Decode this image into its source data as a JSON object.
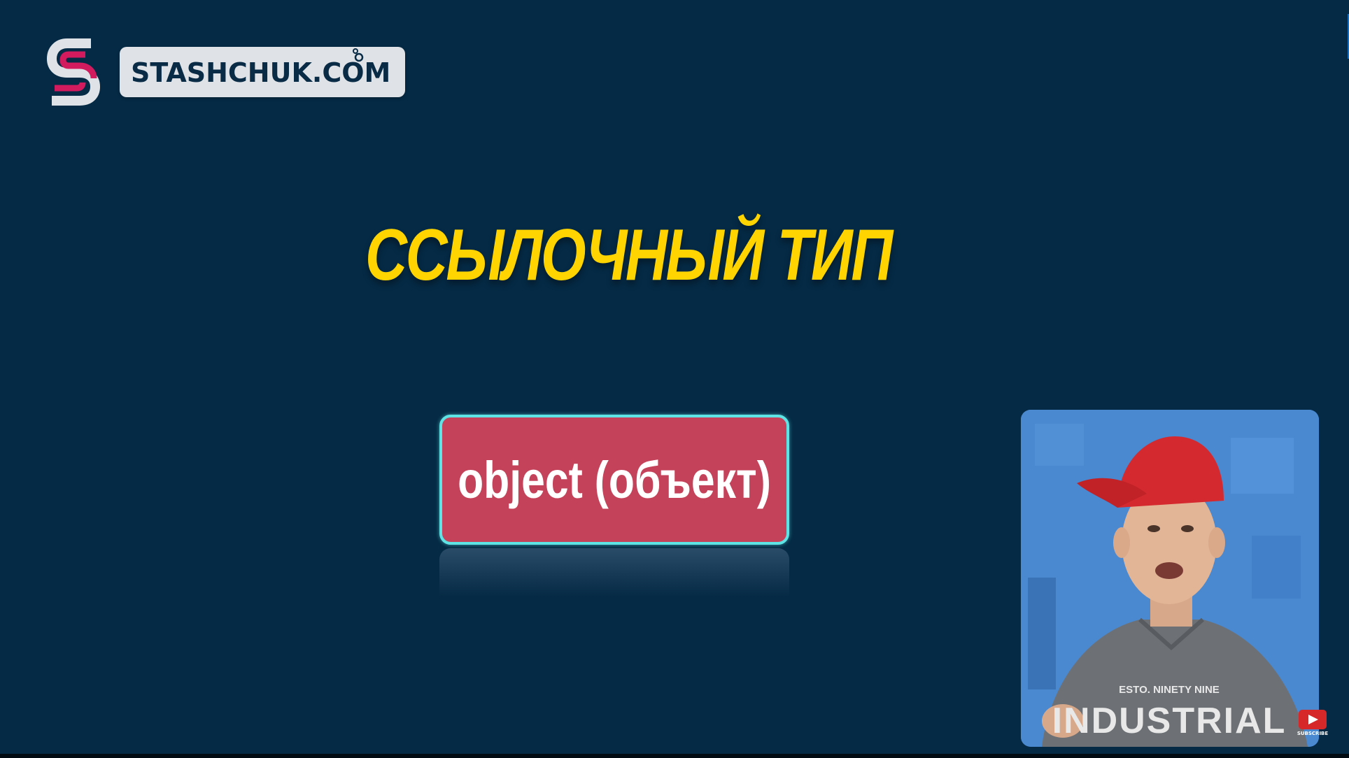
{
  "branding": {
    "site_name": "STASHCHUK.COM",
    "colors": {
      "mark_outline": "#dfe3e7",
      "mark_accent": "#d11b5e",
      "pill_background": "#dfe3e7",
      "text": "#0a2b45"
    }
  },
  "slide": {
    "title": "ССЫЛОЧНЫЙ ТИП",
    "object_label": "object (объект)",
    "colors": {
      "background": "#052a45",
      "title": "#ffd400",
      "box_fill": "#c5435a",
      "box_border": "#5fe4e6"
    }
  },
  "presenter": {
    "shirt_text_top": "ESTO. NINETY NINE",
    "shirt_text_main": "INDUSTRIAL"
  },
  "subscribe": {
    "label": "SUBSCRIBE",
    "icon": "youtube-play-icon"
  }
}
